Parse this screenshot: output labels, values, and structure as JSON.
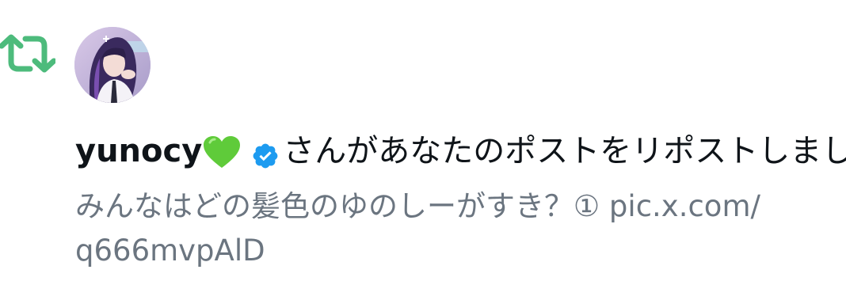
{
  "notification": {
    "type_icon": "repost-icon",
    "avatar_icon": "avatar",
    "username": "yunocy",
    "username_emoji_icon": "green-heart-icon",
    "verified_badge_icon": "verified-badge-icon",
    "action_text": "さんがあなたのポストをリポストしました",
    "post_text_line1": "みんなはどの髪色のゆのしーがすき？① pic.x.com/",
    "post_text_line2": "q666mvpAlD"
  },
  "colors": {
    "repost_green": "#4dbb7c",
    "heart_green": "#5fcb3a",
    "verified_blue": "#1d9bf0",
    "primary_text": "#0f1419",
    "secondary_text": "#6b7580"
  }
}
